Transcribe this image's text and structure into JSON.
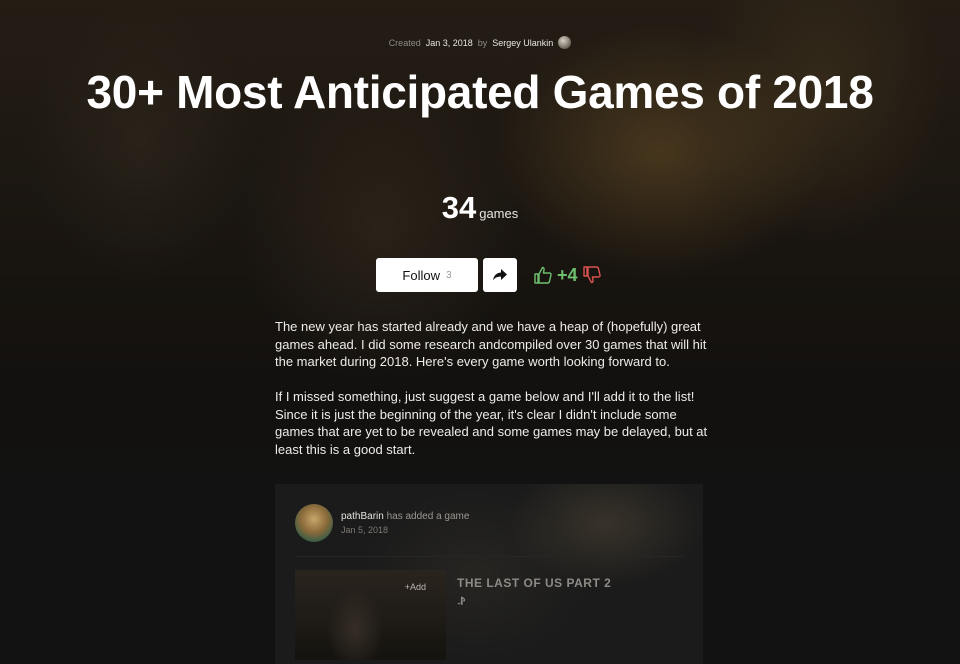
{
  "meta": {
    "created_label": "Created",
    "created_date": "Jan 3, 2018",
    "by_label": "by",
    "author": "Sergey Ulankin"
  },
  "title": "30+ Most Anticipated Games of 2018",
  "count": {
    "number": "34",
    "unit": "games"
  },
  "actions": {
    "follow_label": "Follow",
    "follow_count": "3",
    "vote_score": "+4"
  },
  "description": [
    "The new year has started already and we have a heap of (hopefully) great games ahead. I did some research andcompiled over 30 games that will hit the market during 2018. Here's every game worth looking forward to.",
    "If I missed something, just suggest a game below and I'll add it to the list! Since it is just the beginning of the year, it's clear I didn't include some games that are yet to be revealed and some games may be delayed, but at least this is a good start."
  ],
  "activity": {
    "user": "pathBarin",
    "action": "has added a game",
    "date": "Jan 5, 2018",
    "add_label": "Add",
    "game_title": "THE LAST OF US PART 2",
    "platform_icon": "playstation-icon"
  },
  "colors": {
    "vote_up": "#6fbf6f",
    "vote_down": "#d9534f"
  }
}
